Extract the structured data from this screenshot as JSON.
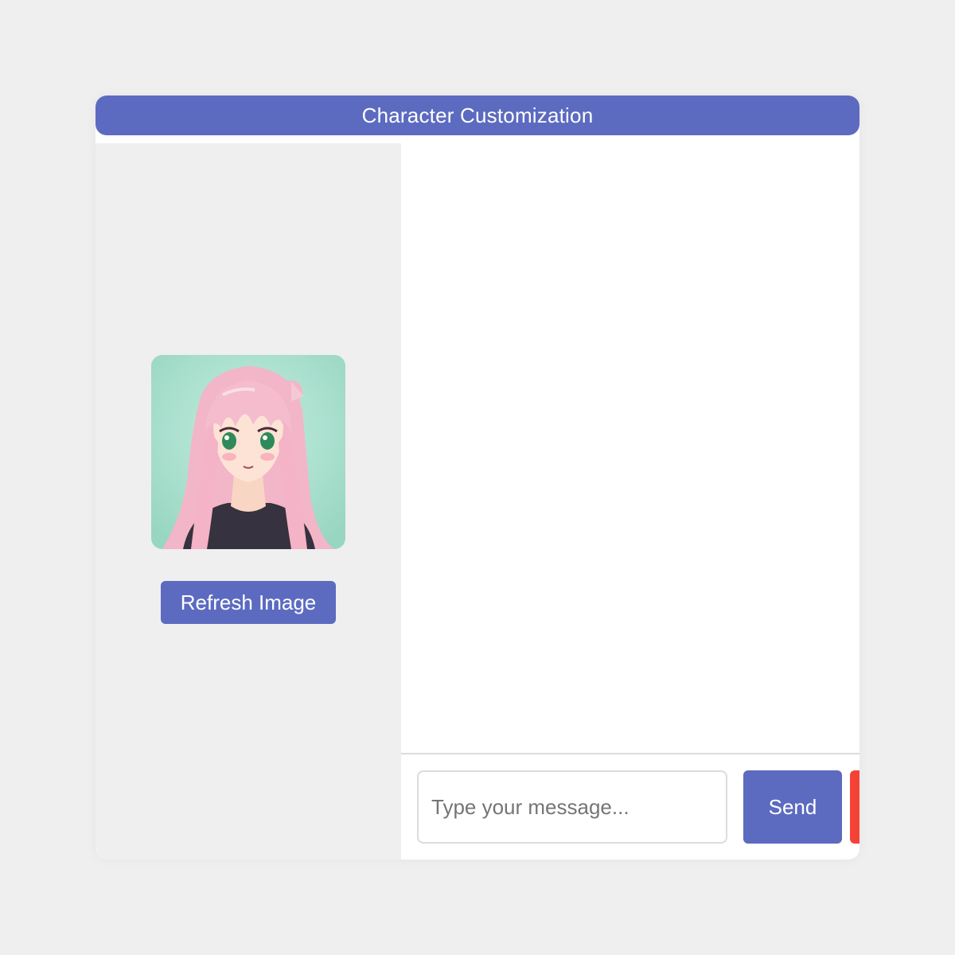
{
  "header": {
    "title": "Character Customization"
  },
  "sidebar": {
    "avatar_icon": "anime-character-portrait",
    "refresh_label": "Refresh Image"
  },
  "composer": {
    "placeholder": "Type your message...",
    "send_label": "Send"
  },
  "colors": {
    "accent": "#5c6bc0",
    "danger": "#f44336",
    "sidebar_bg": "#efefef",
    "page_bg": "#efefef"
  }
}
